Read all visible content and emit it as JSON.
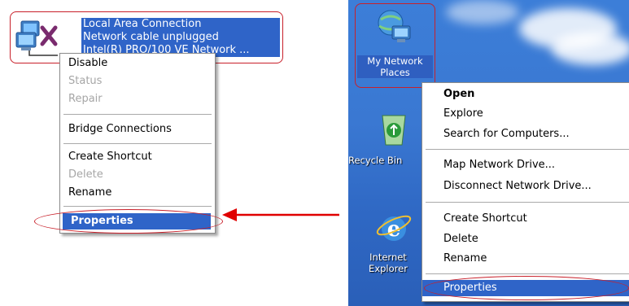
{
  "left": {
    "connection": {
      "name": "Local Area Connection",
      "status": "Network cable unplugged",
      "device": "Intel(R) PRO/100 VE Network ..."
    },
    "menu": [
      {
        "label": "Disable",
        "disabled": false
      },
      {
        "label": "Status",
        "disabled": true
      },
      {
        "label": "Repair",
        "disabled": true
      },
      {
        "label": "Bridge Connections",
        "disabled": false
      },
      {
        "label": "Create Shortcut",
        "disabled": false
      },
      {
        "label": "Delete",
        "disabled": true
      },
      {
        "label": "Rename",
        "disabled": false
      },
      {
        "label": "Properties",
        "selected": true
      }
    ]
  },
  "right": {
    "icons": [
      {
        "label_line1": "My Network",
        "label_line2": "Places",
        "icon": "network-computer-icon"
      },
      {
        "label_line1": "Recycle Bin",
        "icon": "recycle-bin-icon"
      },
      {
        "label_line1": "Internet",
        "label_line2": "Explorer",
        "icon": "internet-explorer-icon"
      }
    ],
    "menu": [
      {
        "label": "Open",
        "bold": true
      },
      {
        "label": "Explore"
      },
      {
        "label": "Search for Computers..."
      },
      {
        "label": "Map Network Drive..."
      },
      {
        "label": "Disconnect Network Drive..."
      },
      {
        "label": "Create Shortcut"
      },
      {
        "label": "Delete"
      },
      {
        "label": "Rename"
      },
      {
        "label": "Properties",
        "selected": true
      }
    ]
  },
  "colors": {
    "highlight": "#2f64c8",
    "annotation": "#c8202a",
    "desktop": "#3a78d2"
  }
}
